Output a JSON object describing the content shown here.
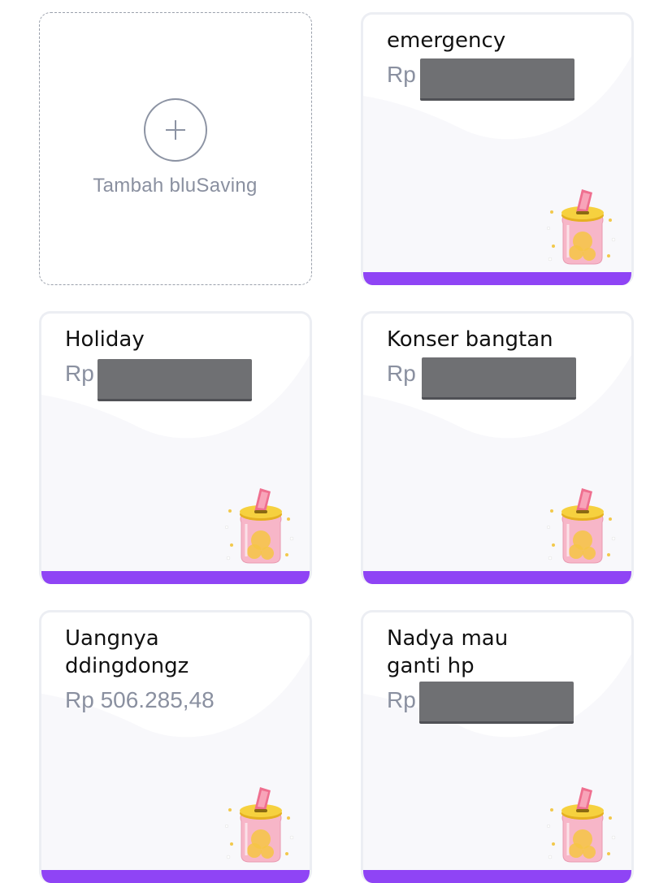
{
  "add_card": {
    "label": "Tambah bluSaving",
    "icon": "plus-icon"
  },
  "accent_color": "#8f44f5",
  "savings": [
    {
      "title": "emergency",
      "currency": "Rp",
      "amount": "",
      "amount_redacted": true,
      "jar_icon": "piggy-jar-icon"
    },
    {
      "title": "Holiday",
      "currency": "Rp",
      "amount": "",
      "amount_redacted": true,
      "jar_icon": "piggy-jar-icon"
    },
    {
      "title": "Konser bangtan",
      "currency": "Rp",
      "amount": "",
      "amount_redacted": true,
      "jar_icon": "piggy-jar-icon"
    },
    {
      "title_line1": "Uangnya",
      "title_line2": "ddingdongz",
      "currency": "Rp",
      "amount": "Rp 506.285,48",
      "amount_redacted": false,
      "jar_icon": "piggy-jar-icon"
    },
    {
      "title_line1": "Nadya mau",
      "title_line2": "ganti hp",
      "currency": "Rp",
      "amount": "",
      "amount_redacted": true,
      "jar_icon": "piggy-jar-icon"
    }
  ]
}
